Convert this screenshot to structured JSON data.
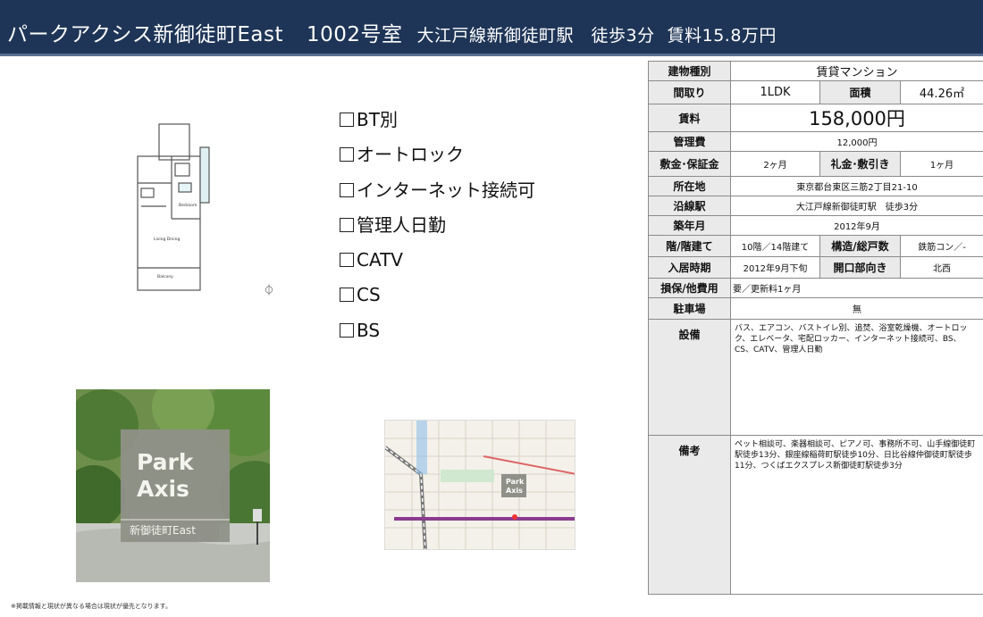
{
  "header": {
    "building": "パークアクシス新御徒町East",
    "room": "1002号室",
    "station": "大江戸線新御徒町駅　徒歩3分",
    "rent": "賃料15.8万円"
  },
  "features": [
    "BT別",
    "オートロック",
    "インターネット接続可",
    "管理人日勤",
    "CATV",
    "CS",
    "BS"
  ],
  "photo": {
    "sign_line1": "Park",
    "sign_line2": "Axis",
    "sign_sub": "新御徒町East"
  },
  "map": {
    "logo_line1": "Park",
    "logo_line2": "Axis"
  },
  "floorplan": {
    "labels": [
      "Bedroom",
      "Living Dining",
      "Balcony"
    ]
  },
  "footnote": "※掲載情報と現状が異なる場合は現状が優先となります。",
  "spec": {
    "type_label": "建物種別",
    "type_value": "賃貸マンション",
    "layout_label": "間取り",
    "layout_value": "1LDK",
    "area_label": "面積",
    "area_value": "44.26㎡",
    "rent_label": "賃料",
    "rent_value": "158,000円",
    "mgmt_label": "管理費",
    "mgmt_value": "12,000円",
    "deposit_label": "敷金･保証金",
    "deposit_value": "2ヶ月",
    "keymoney_label": "礼金･敷引き",
    "keymoney_value": "1ヶ月",
    "address_label": "所在地",
    "address_value": "東京都台東区三筋2丁目21-10",
    "line_label": "沿線駅",
    "line_value": "大江戸線新御徒町駅　徒歩3分",
    "built_label": "築年月",
    "built_value": "2012年9月",
    "floor_label": "階/階建て",
    "floor_value": "10階／14階建て",
    "structure_label": "構造/総戸数",
    "structure_value": "鉄筋コン／-",
    "movein_label": "入居時期",
    "movein_value": "2012年9月下旬",
    "direction_label": "開口部向き",
    "direction_value": "北西",
    "other_label": "損保/他費用",
    "other_value": "要／更新料1ヶ月",
    "parking_label": "駐車場",
    "parking_value": "無",
    "equip_label": "設備",
    "equip_value": "バス、エアコン、バストイレ別、追焚、浴室乾燥機、オートロック、エレベータ、宅配ロッカー、インターネット接続可、BS、CS、CATV、管理人日勤",
    "remarks_label": "備考",
    "remarks_value": "ペット相談可、楽器相談可、ピアノ可、事務所不可、山手線御徒町駅徒歩13分、銀座線稲荷町駅徒歩10分、日比谷線仲御徒町駅徒歩11分、つくばエクスプレス新御徒町駅徒歩3分"
  }
}
